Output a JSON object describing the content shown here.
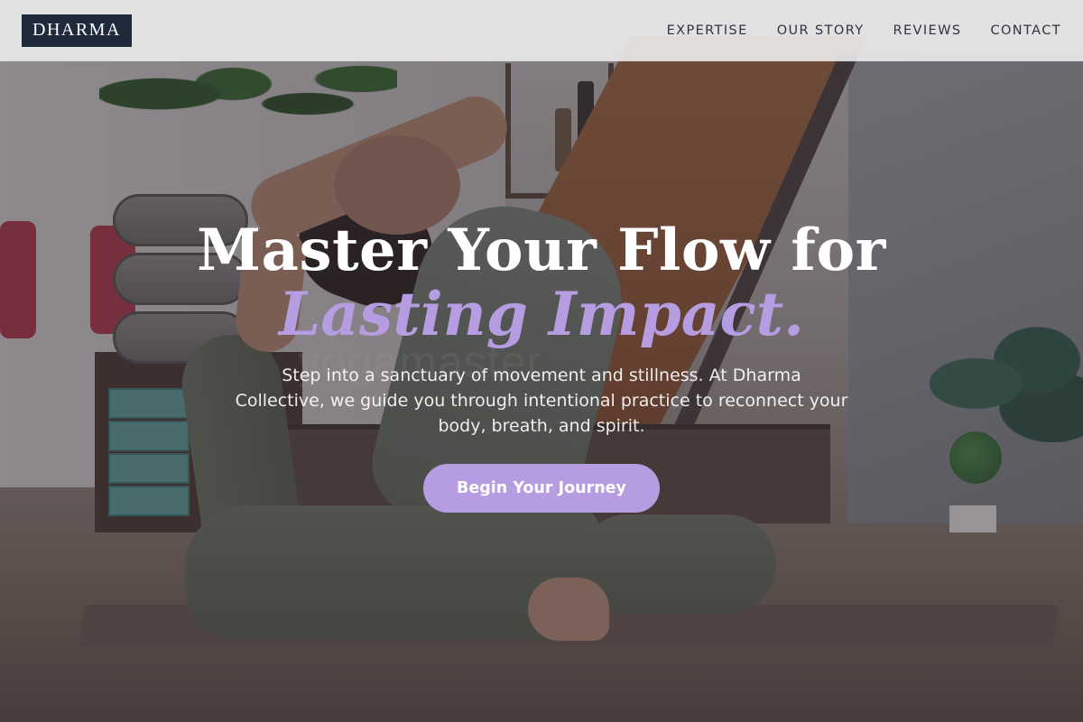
{
  "header": {
    "logo_text": "DHARMA",
    "nav": [
      {
        "label": "EXPERTISE"
      },
      {
        "label": "OUR STORY"
      },
      {
        "label": "REVIEWS"
      },
      {
        "label": "CONTACT"
      }
    ]
  },
  "hero": {
    "title_line1": "Master Your Flow for",
    "title_line2": "Lasting Impact.",
    "watermark": "yogamaster",
    "subtitle": "Step into a sanctuary of movement and stillness. At Dharma Collective, we guide you through intentional practice to reconnect your body, breath, and spirit.",
    "cta_label": "Begin Your Journey"
  },
  "colors": {
    "accent": "#b69ce0",
    "logo_bg": "#1f2a3b",
    "header_bg": "#ececec",
    "title_text": "#ffffff"
  }
}
